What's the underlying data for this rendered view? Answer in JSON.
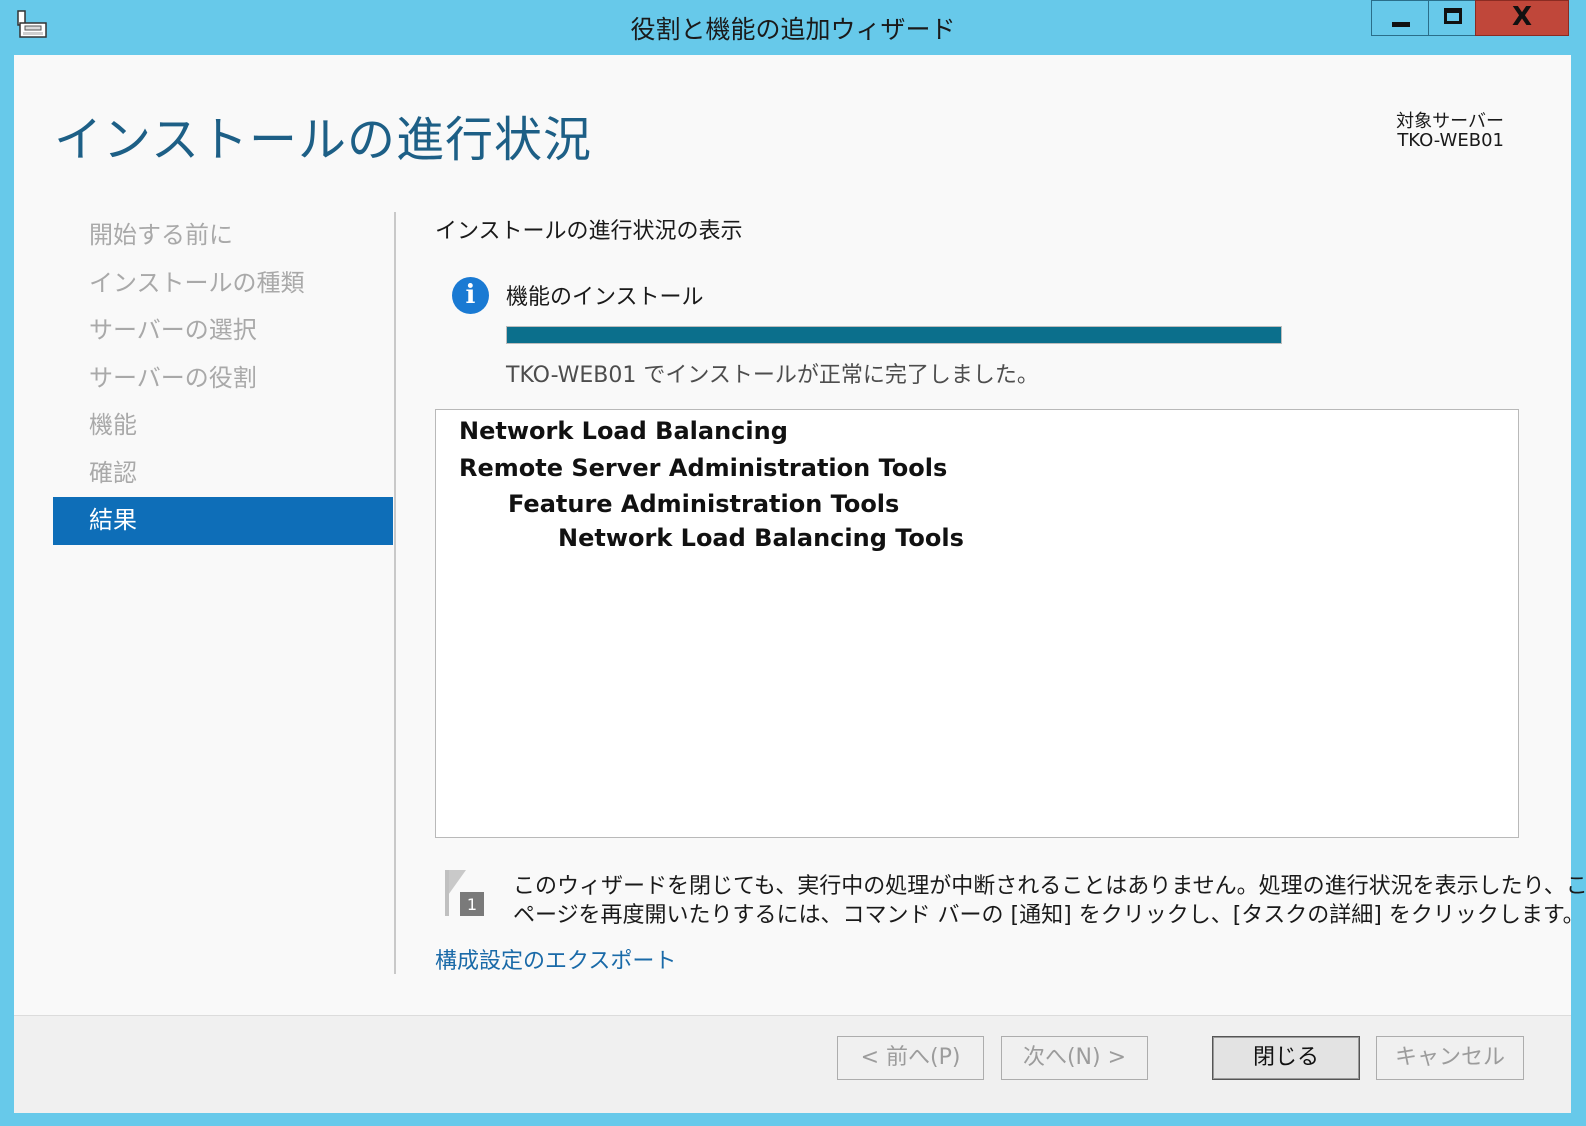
{
  "window": {
    "title": "役割と機能の追加ウィザード",
    "close_glyph": "X"
  },
  "header": {
    "page_title": "インストールの進行状況",
    "target_label": "対象サーバー",
    "target_name": "TKO-WEB01"
  },
  "nav": {
    "items": [
      {
        "label": "開始する前に",
        "active": false
      },
      {
        "label": "インストールの種類",
        "active": false
      },
      {
        "label": "サーバーの選択",
        "active": false
      },
      {
        "label": "サーバーの役割",
        "active": false
      },
      {
        "label": "機能",
        "active": false
      },
      {
        "label": "確認",
        "active": false
      },
      {
        "label": "結果",
        "active": true
      }
    ]
  },
  "main": {
    "section_title": "インストールの進行状況の表示",
    "info_icon_glyph": "i",
    "feature_title": "機能のインストール",
    "progress_percent": 100,
    "status_text": "TKO-WEB01 でインストールが正常に完了しました。",
    "results": [
      {
        "label": "Network Load Balancing",
        "indent": 0
      },
      {
        "label": "Remote Server Administration Tools",
        "indent": 0
      },
      {
        "label": "Feature Administration Tools",
        "indent": 1
      },
      {
        "label": "Network Load Balancing Tools",
        "indent": 2
      }
    ],
    "note_icon_badge": "1",
    "note_lines": [
      "このウィザードを閉じても、実行中の処理が中断されることはありません。処理の進行状況を表示したり、この",
      "ページを再度開いたりするには、コマンド バーの [通知] をクリックし、[タスクの詳細] をクリックします。"
    ],
    "export_link": "構成設定のエクスポート"
  },
  "footer": {
    "prev_label": "< 前へ(P)",
    "next_label": "次へ(N) >",
    "close_label": "閉じる",
    "cancel_label": "キャンセル"
  },
  "colors": {
    "chrome": "#67c9ea",
    "title_accent": "#1d5f86",
    "nav_active": "#0e6eb8",
    "progress": "#0b6f8c",
    "link": "#1a6aa8"
  },
  "icons": [
    "server-manager-icon",
    "minimize-icon",
    "maximize-icon",
    "close-icon",
    "info-icon",
    "notification-flag-icon"
  ]
}
